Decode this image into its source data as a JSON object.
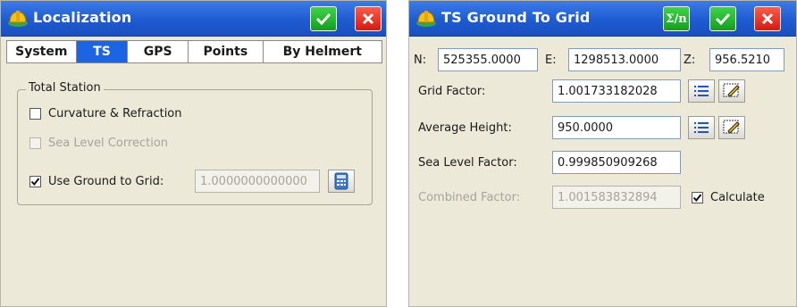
{
  "left_window": {
    "title": "Localization",
    "tabs": [
      {
        "label": "System",
        "active": false
      },
      {
        "label": "TS",
        "active": true
      },
      {
        "label": "GPS",
        "active": false
      },
      {
        "label": "Points",
        "active": false
      },
      {
        "label": "By Helmert",
        "active": false
      }
    ],
    "group_title": "Total Station",
    "options": {
      "curvature": {
        "label": "Curvature & Refraction",
        "checked": false,
        "enabled": true
      },
      "sea_level": {
        "label": "Sea Level Correction",
        "checked": false,
        "enabled": false
      },
      "ground_to_grid": {
        "label": "Use Ground to Grid:",
        "checked": true,
        "enabled": true,
        "value": "1.0000000000000"
      }
    }
  },
  "right_window": {
    "title": "TS Ground To Grid",
    "sigma_label": "Σ/n",
    "coords": {
      "n_label": "N:",
      "n_value": "525355.0000",
      "e_label": "E:",
      "e_value": "1298513.0000",
      "z_label": "Z:",
      "z_value": "956.5210"
    },
    "grid_factor": {
      "label": "Grid Factor:",
      "value": "1.001733182028"
    },
    "average_height": {
      "label": "Average Height:",
      "value": "950.0000"
    },
    "sea_level_factor": {
      "label": "Sea Level Factor:",
      "value": "0.999850909268"
    },
    "combined_factor": {
      "label": "Combined Factor:",
      "value": "1.001583832894"
    },
    "calculate": {
      "label": "Calculate",
      "checked": true
    }
  },
  "colors": {
    "titlebar": "#1e5bd1",
    "active_tab": "#1c64e2",
    "ok_button": "#12a01c",
    "cancel_button": "#d41a10",
    "window_bg": "#ece9d8"
  },
  "icons": {
    "app": "hardhat-icon",
    "ok": "checkmark-icon",
    "cancel": "close-icon",
    "sigma": "sigma-n-icon",
    "list": "list-icon",
    "edit": "edit-pencil-icon",
    "calc": "calculator-icon"
  }
}
